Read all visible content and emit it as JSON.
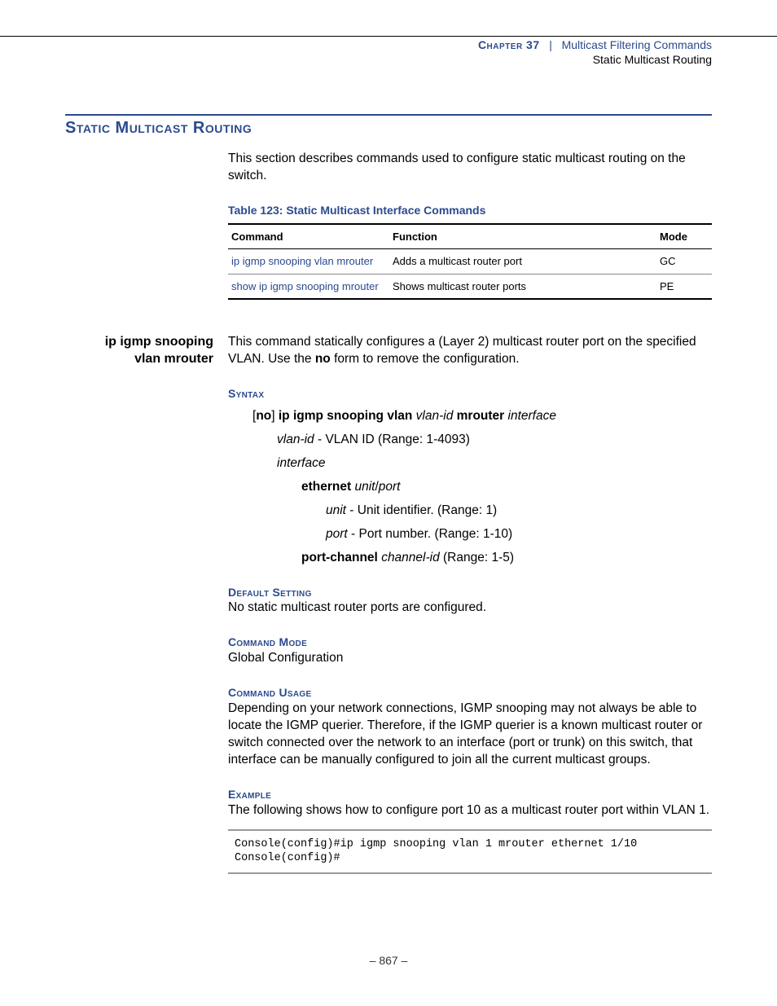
{
  "header": {
    "chapter_label": "Chapter 37",
    "chapter_title": "Multicast Filtering Commands",
    "subtitle": "Static Multicast Routing"
  },
  "section": {
    "title": "Static Multicast Routing",
    "intro": "This section describes commands used to configure static multicast routing on the switch."
  },
  "table": {
    "title": "Table 123: Static Multicast Interface Commands",
    "headers": {
      "command": "Command",
      "function": "Function",
      "mode": "Mode"
    },
    "rows": [
      {
        "command": "ip igmp snooping vlan mrouter",
        "function": "Adds a multicast router port",
        "mode": "GC"
      },
      {
        "command": "show ip igmp snooping mrouter",
        "function": "Shows multicast router ports",
        "mode": "PE"
      }
    ]
  },
  "command": {
    "name_l1": "ip igmp snooping",
    "name_l2": "vlan mrouter",
    "desc_pre": "This command statically configures a (Layer 2) multicast router port on the specified VLAN. Use the ",
    "desc_bold": "no",
    "desc_post": " form to remove the configuration.",
    "syntax": {
      "label": "Syntax",
      "line": {
        "p1": "[",
        "b1": "no",
        "p2": "] ",
        "b2": "ip igmp snooping vlan",
        "sp1": " ",
        "i1": "vlan-id",
        "sp2": " ",
        "b3": "mrouter",
        "sp3": " ",
        "i2": "interface"
      },
      "vlan_id": {
        "name": "vlan-id",
        "desc": " - VLAN ID (Range: 1-4093)"
      },
      "interface_label": "interface",
      "ethernet": {
        "kw": "ethernet",
        "sp": " ",
        "unit": "unit",
        "slash": "/",
        "port": "port"
      },
      "unit": {
        "name": "unit",
        "desc": " - Unit identifier. (Range: 1)"
      },
      "port": {
        "name": "port",
        "desc": " - Port number. (Range: 1-10)"
      },
      "portchannel": {
        "kw": "port-channel",
        "sp": " ",
        "arg": "channel-id",
        "desc": " (Range: 1-5)"
      }
    },
    "default": {
      "label": "Default Setting",
      "text": "No static multicast router ports are configured."
    },
    "mode": {
      "label": "Command Mode",
      "text": "Global Configuration"
    },
    "usage": {
      "label": "Command Usage",
      "text": "Depending on your network connections, IGMP snooping may not always be able to locate the IGMP querier. Therefore, if the IGMP querier is a known multicast router or switch connected over the network to an interface (port or trunk) on this switch, that interface can be manually configured to join all the current multicast groups."
    },
    "example": {
      "label": "Example",
      "intro": "The following shows how to configure port 10 as a multicast router port within VLAN 1.",
      "code": "Console(config)#ip igmp snooping vlan 1 mrouter ethernet 1/10\nConsole(config)#"
    }
  },
  "footer": {
    "page": "–  867  –"
  }
}
